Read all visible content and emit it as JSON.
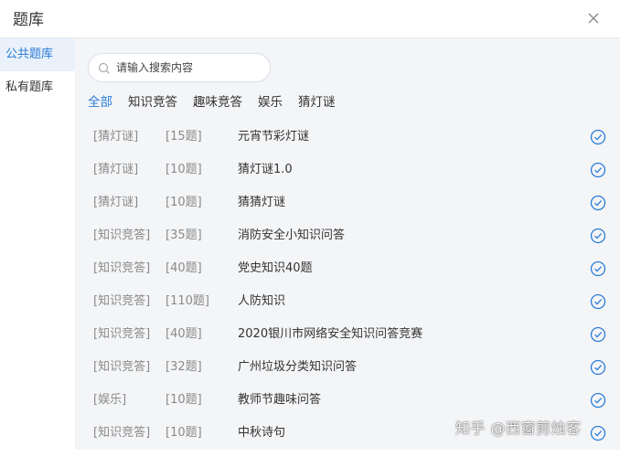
{
  "dialog": {
    "title": "题库",
    "close_icon": "close-icon"
  },
  "sidebar": {
    "items": [
      {
        "label": "公共题库",
        "active": true
      },
      {
        "label": "私有题库",
        "active": false
      }
    ]
  },
  "search": {
    "placeholder": "请输入搜索内容",
    "value": "",
    "icon": "search-icon"
  },
  "tabs": [
    {
      "label": "全部",
      "active": true
    },
    {
      "label": "知识竞答"
    },
    {
      "label": "趣味竞答"
    },
    {
      "label": "娱乐"
    },
    {
      "label": "猜灯谜"
    }
  ],
  "rows": [
    {
      "category": "[猜灯谜]",
      "count": "[15题]",
      "name": "元宵节彩灯谜"
    },
    {
      "category": "[猜灯谜]",
      "count": "[10题]",
      "name": "猜灯谜1.0"
    },
    {
      "category": "[猜灯谜]",
      "count": "[10题]",
      "name": "猜猜灯谜"
    },
    {
      "category": "[知识竞答]",
      "count": "[35题]",
      "name": "消防安全小知识问答"
    },
    {
      "category": "[知识竞答]",
      "count": "[40题]",
      "name": "党史知识40题"
    },
    {
      "category": "[知识竞答]",
      "count": "[110题]",
      "name": "人防知识"
    },
    {
      "category": "[知识竞答]",
      "count": "[40题]",
      "name": "2020银川市网络安全知识问答竞赛"
    },
    {
      "category": "[知识竞答]",
      "count": "[32题]",
      "name": "广州垃圾分类知识问答"
    },
    {
      "category": "[娱乐]",
      "count": "[10题]",
      "name": "教师节趣味问答"
    },
    {
      "category": "[知识竞答]",
      "count": "[10题]",
      "name": "中秋诗句"
    }
  ],
  "colors": {
    "accent": "#2b7cd8",
    "muted": "#8a8a8a",
    "panel": "#f4f5f7",
    "active_bg": "#eaf1fb"
  },
  "watermark": "知乎 @西窗剪烛客"
}
